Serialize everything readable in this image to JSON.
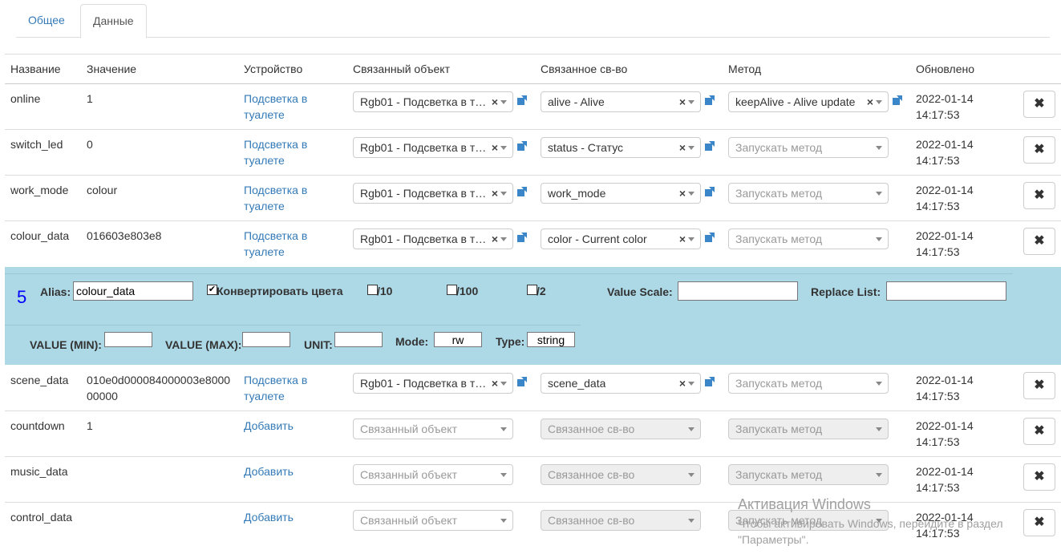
{
  "tabs": {
    "general": "Общее",
    "data": "Данные"
  },
  "table": {
    "headers": {
      "name": "Название",
      "value": "Значение",
      "device": "Устройство",
      "object": "Связанный объект",
      "property": "Связанное св-во",
      "method": "Метод",
      "updated": "Обновлено"
    },
    "rows": [
      {
        "name": "online",
        "value": "1",
        "device": "Подсветка в туалете",
        "object": "Rgb01 - Подсветка в т…",
        "property": "alive - Alive",
        "method": "keepAlive - Alive update",
        "date": "2022-01-14",
        "time": "14:17:53"
      },
      {
        "name": "switch_led",
        "value": "0",
        "device": "Подсветка в туалете",
        "object": "Rgb01 - Подсветка в т…",
        "property": "status - Статус",
        "method": "Запускать метод",
        "date": "2022-01-14",
        "time": "14:17:53"
      },
      {
        "name": "work_mode",
        "value": "colour",
        "device": "Подсветка в туалете",
        "object": "Rgb01 - Подсветка в т…",
        "property": "work_mode",
        "method": "Запускать метод",
        "date": "2022-01-14",
        "time": "14:17:53"
      },
      {
        "name": "colour_data",
        "value": "016603e803e8",
        "device": "Подсветка в туалете",
        "object": "Rgb01 - Подсветка в т…",
        "property": "color - Current color",
        "method": "Запускать метод",
        "date": "2022-01-14",
        "time": "14:17:53"
      },
      {
        "name": "scene_data",
        "value": "010e0d000084000003e800000000",
        "device": "Подсветка в туалете",
        "object": "Rgb01 - Подсветка в т…",
        "property": "scene_data",
        "method": "Запускать метод",
        "date": "2022-01-14",
        "time": "14:17:53"
      },
      {
        "name": "countdown",
        "value": "1",
        "device": "Добавить",
        "object": "Связанный объект",
        "property": "Связанное св-во",
        "method": "Запускать метод",
        "date": "2022-01-14",
        "time": "14:17:53"
      },
      {
        "name": "music_data",
        "value": "",
        "device": "Добавить",
        "object": "Связанный объект",
        "property": "Связанное св-во",
        "method": "Запускать метод",
        "date": "2022-01-14",
        "time": "14:17:53"
      },
      {
        "name": "control_data",
        "value": "",
        "device": "Добавить",
        "object": "Связанный объект",
        "property": "Связанное св-во",
        "method": "Запускать метод",
        "date": "2022-01-14",
        "time": "14:17:53"
      }
    ],
    "delete_glyph": "✖"
  },
  "panel": {
    "number": "5",
    "alias_label": "Alias:",
    "alias_value": "colour_data",
    "convert_label": "Конвертировать цвета",
    "convert_checked": true,
    "div10_label": "/10",
    "div100_label": "/100",
    "div2_label": "/2",
    "value_scale_label": "Value Scale:",
    "value_scale_value": "",
    "replace_list_label": "Replace List:",
    "replace_list_value": "",
    "min_label": "VALUE (MIN):",
    "min_value": "",
    "max_label": "VALUE (MAX):",
    "max_value": "",
    "unit_label": "UNIT:",
    "unit_value": "",
    "mode_label": "Mode:",
    "mode_value": "rw",
    "type_label": "Type:",
    "type_value": "string",
    "check_glyph": "✔"
  },
  "watermark": {
    "title": "Активация Windows",
    "text": "Чтобы активировать Windows, перейдите в раздел \"Параметры\"."
  },
  "colors": {
    "panel_bg": "#add8e6",
    "link": "#337ab7",
    "number": "#0000ff"
  }
}
